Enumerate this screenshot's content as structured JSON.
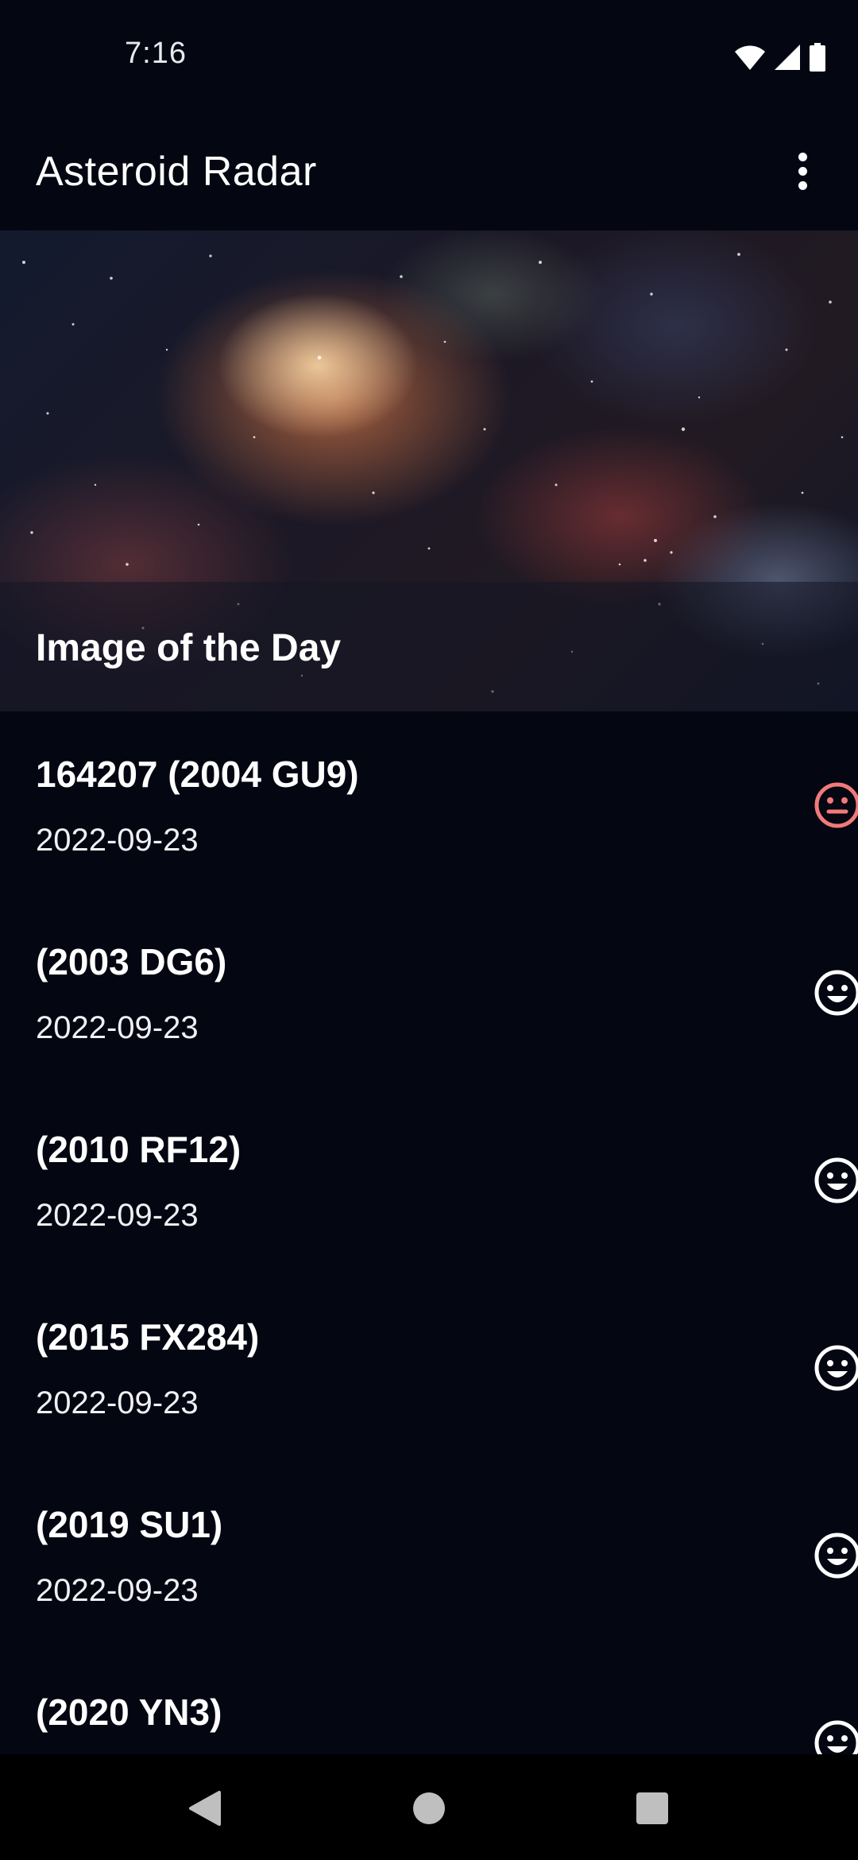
{
  "status_bar": {
    "time": "7:16",
    "icons": [
      "wifi-icon",
      "signal-icon",
      "battery-icon"
    ]
  },
  "app_bar": {
    "title": "Asteroid Radar",
    "menu_icon": "more-vert-icon"
  },
  "image_of_day": {
    "caption": "Image of the Day"
  },
  "asteroids": [
    {
      "name": "164207 (2004 GU9)",
      "date": "2022-09-23",
      "status_icon": "neutral-face-icon",
      "hazardous": true
    },
    {
      "name": "(2003 DG6)",
      "date": "2022-09-23",
      "status_icon": "happy-face-icon",
      "hazardous": false
    },
    {
      "name": "(2010 RF12)",
      "date": "2022-09-23",
      "status_icon": "happy-face-icon",
      "hazardous": false
    },
    {
      "name": "(2015 FX284)",
      "date": "2022-09-23",
      "status_icon": "happy-face-icon",
      "hazardous": false
    },
    {
      "name": "(2019 SU1)",
      "date": "2022-09-23",
      "status_icon": "happy-face-icon",
      "hazardous": false
    },
    {
      "name": "(2020 YN3)",
      "date": "",
      "status_icon": "happy-face-icon",
      "hazardous": false
    }
  ],
  "colors": {
    "background": "#040612",
    "hazardous": "#f07a7a",
    "safe": "#ffffff"
  },
  "nav_bar": {
    "icons": [
      "back-icon",
      "home-icon",
      "recents-icon"
    ]
  }
}
